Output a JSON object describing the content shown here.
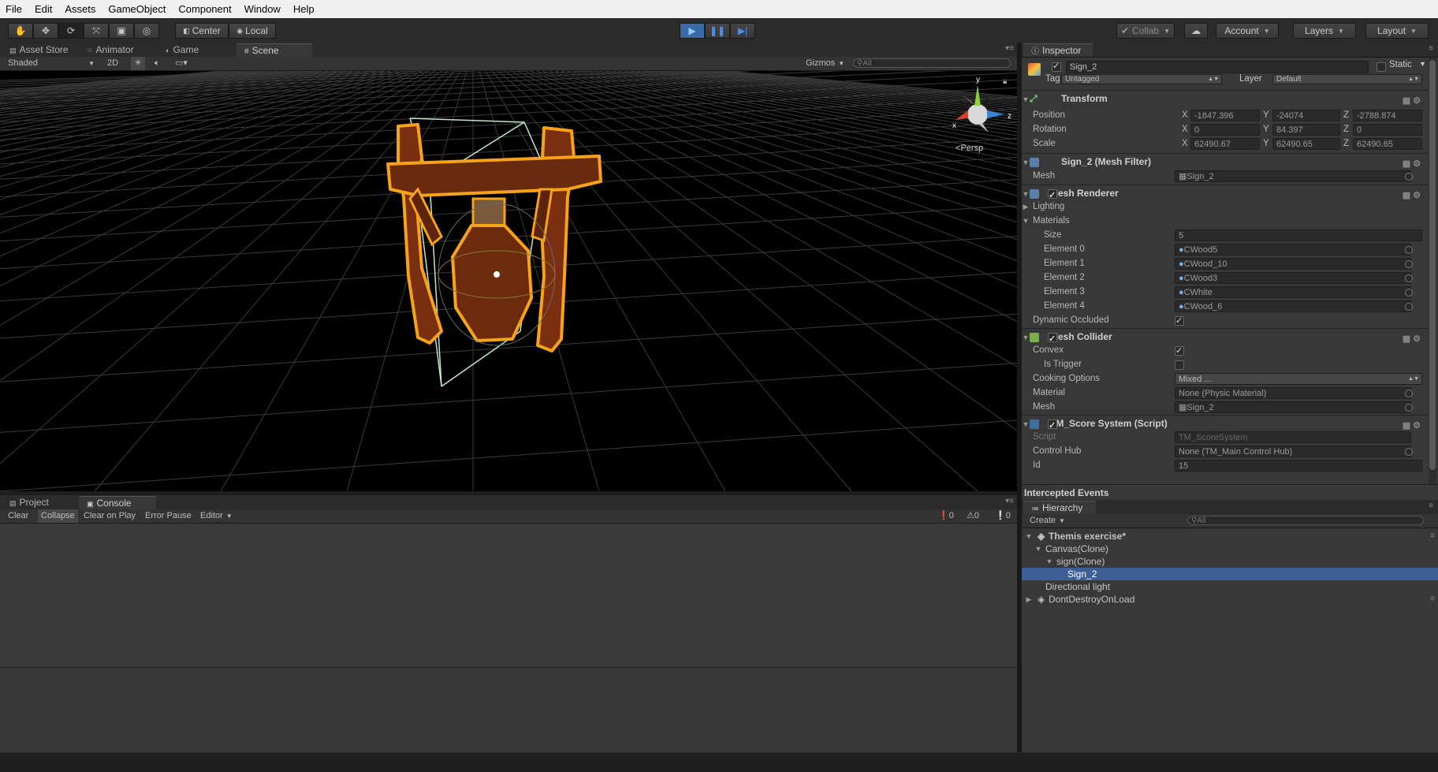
{
  "menu": [
    "File",
    "Edit",
    "Assets",
    "GameObject",
    "Component",
    "Window",
    "Help"
  ],
  "toolbar": {
    "pivot": "Center",
    "space": "Local",
    "collab": "Collab",
    "account": "Account",
    "layers": "Layers",
    "layout": "Layout"
  },
  "scene_tabs": [
    "Asset Store",
    "Animator",
    "Game",
    "Scene"
  ],
  "scene_bar": {
    "shading": "Shaded",
    "mode2d": "2D",
    "gizmos": "Gizmos",
    "search_placeholder": "All",
    "persp": "Persp"
  },
  "inspector": {
    "tab": "Inspector",
    "object_name": "Sign_2",
    "static_label": "Static",
    "tag_label": "Tag",
    "tag": "Untagged",
    "layer_label": "Layer",
    "layer": "Default",
    "transform": {
      "title": "Transform",
      "position_label": "Position",
      "position": [
        "-1847.396",
        "-24074",
        "-2788.874"
      ],
      "rotation_label": "Rotation",
      "rotation": [
        "0",
        "84.397",
        "0"
      ],
      "scale_label": "Scale",
      "scale": [
        "62490.67",
        "62490.65",
        "62490.65"
      ]
    },
    "mesh_filter": {
      "title": "Sign_2 (Mesh Filter)",
      "mesh_label": "Mesh",
      "mesh": "Sign_2"
    },
    "mesh_renderer": {
      "title": "Mesh Renderer",
      "lighting": "Lighting",
      "materials": "Materials",
      "size_label": "Size",
      "size": "5",
      "elements": [
        {
          "label": "Element 0",
          "value": "CWood5"
        },
        {
          "label": "Element 1",
          "value": "CWood_10"
        },
        {
          "label": "Element 2",
          "value": "CWood3"
        },
        {
          "label": "Element 3",
          "value": "CWhite"
        },
        {
          "label": "Element 4",
          "value": "CWood_6"
        }
      ],
      "dynamic_occluded": "Dynamic Occluded"
    },
    "mesh_collider": {
      "title": "Mesh Collider",
      "convex": "Convex",
      "is_trigger": "Is Trigger",
      "cooking_label": "Cooking Options",
      "cooking": "Mixed ...",
      "material_label": "Material",
      "material": "None (Physic Material)",
      "mesh_label": "Mesh",
      "mesh": "Sign_2"
    },
    "score_system": {
      "title": "TM_Score System (Script)",
      "script_label": "Script",
      "script": "TM_ScoreSystem",
      "hub_label": "Control Hub",
      "hub": "None (TM_Main Control Hub)",
      "id_label": "Id",
      "id": "15"
    },
    "intercepted": "Intercepted Events"
  },
  "hierarchy": {
    "tab": "Hierarchy",
    "create": "Create",
    "search_placeholder": "All",
    "items": [
      {
        "label": "Themis exercise*"
      },
      {
        "label": "Canvas(Clone)"
      },
      {
        "label": "sign(Clone)"
      },
      {
        "label": "Sign_2"
      },
      {
        "label": "Directional light"
      },
      {
        "label": "DontDestroyOnLoad"
      }
    ]
  },
  "console": {
    "tabs": [
      "Project",
      "Console"
    ],
    "buttons": [
      "Clear",
      "Collapse",
      "Clear on Play",
      "Error Pause",
      "Editor"
    ],
    "counts": [
      "0",
      "0",
      "0"
    ]
  },
  "colors": {
    "accent": "#3e5f96",
    "play": "#3a6aa8",
    "selection_outline": "#f7a21b"
  }
}
